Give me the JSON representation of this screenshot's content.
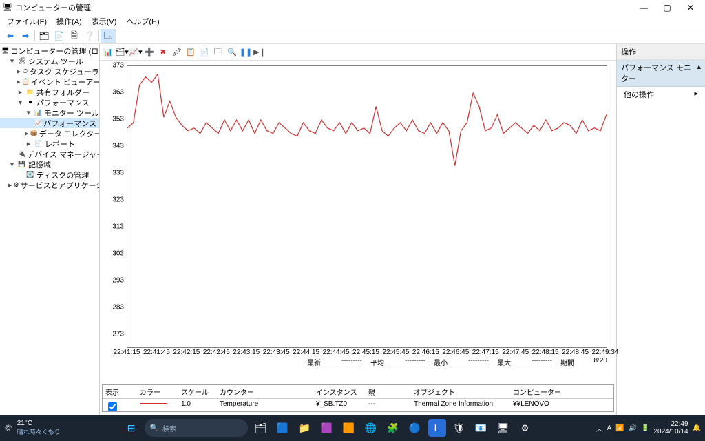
{
  "window": {
    "title": "コンピューターの管理",
    "menu": [
      "ファイル(F)",
      "操作(A)",
      "表示(V)",
      "ヘルプ(H)"
    ]
  },
  "tree": {
    "nodes": [
      {
        "depth": 0,
        "tw": "",
        "icon": "🖥",
        "label": "コンピューターの管理 (ローカル)"
      },
      {
        "depth": 1,
        "tw": "▾",
        "icon": "🛠",
        "label": "システム ツール"
      },
      {
        "depth": 2,
        "tw": "▸",
        "icon": "⏱",
        "label": "タスク スケジューラ"
      },
      {
        "depth": 2,
        "tw": "▸",
        "icon": "📋",
        "label": "イベント ビューアー"
      },
      {
        "depth": 2,
        "tw": "▸",
        "icon": "📁",
        "label": "共有フォルダー"
      },
      {
        "depth": 2,
        "tw": "▾",
        "icon": "⏺",
        "label": "パフォーマンス"
      },
      {
        "depth": 3,
        "tw": "▾",
        "icon": "📊",
        "label": "モニター ツール"
      },
      {
        "depth": 4,
        "tw": "",
        "icon": "📈",
        "label": "パフォーマンス モニタ",
        "selected": true
      },
      {
        "depth": 3,
        "tw": "▸",
        "icon": "📦",
        "label": "データ コレクター セット"
      },
      {
        "depth": 3,
        "tw": "▸",
        "icon": "📄",
        "label": "レポート"
      },
      {
        "depth": 2,
        "tw": "",
        "icon": "🔌",
        "label": "デバイス マネージャー"
      },
      {
        "depth": 1,
        "tw": "▾",
        "icon": "💾",
        "label": "記憶域"
      },
      {
        "depth": 2,
        "tw": "",
        "icon": "💽",
        "label": "ディスクの管理"
      },
      {
        "depth": 1,
        "tw": "▸",
        "icon": "⚙",
        "label": "サービスとアプリケーション"
      }
    ]
  },
  "actions": {
    "header": "操作",
    "group": "パフォーマンス モニター",
    "other": "他の操作"
  },
  "chart_data": {
    "type": "line",
    "ylabel": "",
    "ylim": [
      273,
      373
    ],
    "yticks": [
      273,
      283,
      293,
      303,
      313,
      323,
      333,
      343,
      353,
      363,
      373
    ],
    "xticks": [
      "22:41:15",
      "22:41:45",
      "22:42:15",
      "22:42:45",
      "22:43:15",
      "22:43:45",
      "22:44:15",
      "22:44:45",
      "22:45:15",
      "22:45:45",
      "22:46:15",
      "22:46:45",
      "22:47:15",
      "22:47:45",
      "22:48:15",
      "22:48:45",
      "22:49:34"
    ],
    "series": [
      {
        "name": "Temperature",
        "color": "#d32f2f",
        "values": [
          350,
          352,
          366,
          369,
          367,
          370,
          354,
          360,
          354,
          351,
          349,
          350,
          348,
          352,
          350,
          348,
          353,
          349,
          353,
          349,
          353,
          348,
          353,
          349,
          348,
          352,
          350,
          348,
          347,
          352,
          349,
          348,
          353,
          350,
          349,
          352,
          348,
          352,
          349,
          350,
          348,
          358,
          349,
          347,
          350,
          352,
          349,
          353,
          349,
          348,
          352,
          348,
          352,
          349,
          336,
          349,
          352,
          363,
          358,
          349,
          350,
          355,
          348,
          350,
          352,
          350,
          348,
          351,
          349,
          353,
          349,
          350,
          352,
          351,
          348,
          353,
          349,
          350,
          349,
          355
        ]
      }
    ],
    "stats": {
      "latest_lbl": "最新",
      "avg_lbl": "平均",
      "min_lbl": "最小",
      "max_lbl": "最大",
      "dur_lbl": "期間",
      "latest": "---------",
      "avg": "---------",
      "min": "---------",
      "max": "---------",
      "duration": "8:20"
    }
  },
  "legend": {
    "headers": {
      "show": "表示",
      "color": "カラー",
      "scale": "スケール",
      "counter": "カウンター",
      "instance": "インスタンス",
      "parent": "親",
      "object": "オブジェクト",
      "computer": "コンピューター"
    },
    "row": {
      "scale": "1.0",
      "counter": "Temperature",
      "instance": "¥_SB.TZ0",
      "parent": "---",
      "object": "Thermal Zone Information",
      "computer": "¥¥LENOVO"
    }
  },
  "taskbar": {
    "temp": "21°C",
    "weather": "晴れ時々くもり",
    "search": "検索",
    "time": "22:49",
    "date": "2024/10/14"
  }
}
